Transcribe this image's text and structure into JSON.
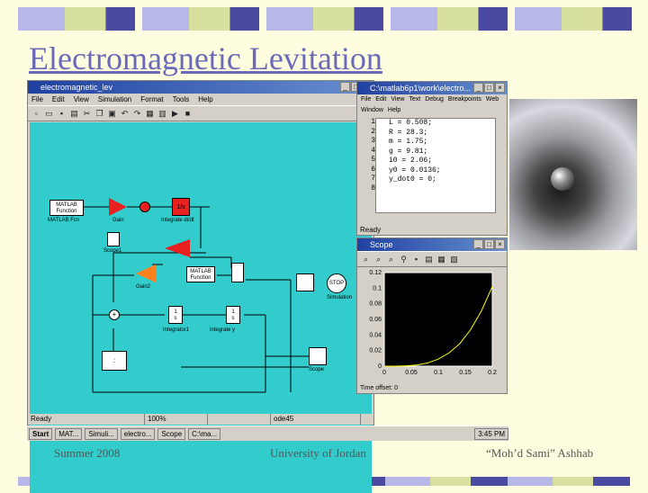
{
  "slide": {
    "title": "Electromagnetic Levitation",
    "footer_left": "Summer 2008",
    "footer_center": "University of Jordan",
    "footer_right": "“Moh’d Sami” Ashhab"
  },
  "simulink": {
    "window_title": "electromagnetic_lev",
    "menu": [
      "File",
      "Edit",
      "View",
      "Simulation",
      "Format",
      "Tools",
      "Help"
    ],
    "blocks": {
      "matlab_fcn1": "MATLAB Function",
      "matlab_fcn1_label": "MATLAB Fcn",
      "gain": "Gain",
      "integrate_didt": "Integrate di/dt",
      "scope1": "Scope1",
      "gain2": "Gain2",
      "matlab_fcn2": "MATLAB Function",
      "integrator1_label": "Integrator1",
      "integrate_y_label": "integrate y",
      "simulation_label": "Simulation",
      "stop": "STOP",
      "scope_label": "Scope"
    },
    "status": [
      "Ready",
      "100%",
      "",
      "ode45"
    ]
  },
  "editor": {
    "window_title": "C:\\matlab6p1\\work\\electro...",
    "menu": [
      "File",
      "Edit",
      "View",
      "Text",
      "Debug",
      "Breakpoints",
      "Web",
      "Window",
      "Help"
    ],
    "line_numbers": [
      "1",
      "2",
      "3",
      "4",
      "5",
      "6",
      "7",
      "8"
    ],
    "lines": [
      "L = 0.508;",
      "R = 28.3;",
      "m = 1.75;",
      "g = 9.81;",
      "i0 = 2.06;",
      "y0 = 0.0136;",
      "y_dot0 = 0;",
      ""
    ],
    "status": "Ready"
  },
  "scope": {
    "window_title": "Scope",
    "time_offset": "Time offset:  0",
    "chart_data": {
      "type": "line",
      "x_ticks": [
        "0",
        "0.05",
        "0.1",
        "0.15",
        "0.2"
      ],
      "y_ticks": [
        "0.12",
        "0.1",
        "0.08",
        "0.06",
        "0.04",
        "0.02",
        "0"
      ],
      "xlim": [
        0,
        0.2
      ],
      "ylim": [
        0,
        0.12
      ],
      "series": [
        {
          "x": [
            0,
            0.02,
            0.04,
            0.06,
            0.08,
            0.1,
            0.12,
            0.14,
            0.16,
            0.18,
            0.2
          ],
          "y": [
            0.0,
            0.0,
            0.0005,
            0.0015,
            0.004,
            0.009,
            0.017,
            0.029,
            0.047,
            0.071,
            0.102
          ]
        }
      ]
    }
  },
  "taskbar": {
    "start": "Start",
    "tasks": [
      "MAT...",
      "Simuli...",
      "electro...",
      "Scope",
      "C:\\ma..."
    ],
    "clock": "3:45 PM"
  },
  "colors": {
    "deco": [
      "#c8c8ee",
      "#d8e0a0",
      "#4a4aa0",
      "#e0e8b0"
    ],
    "canvas": "#33cccc",
    "red_block": "#e82020"
  }
}
